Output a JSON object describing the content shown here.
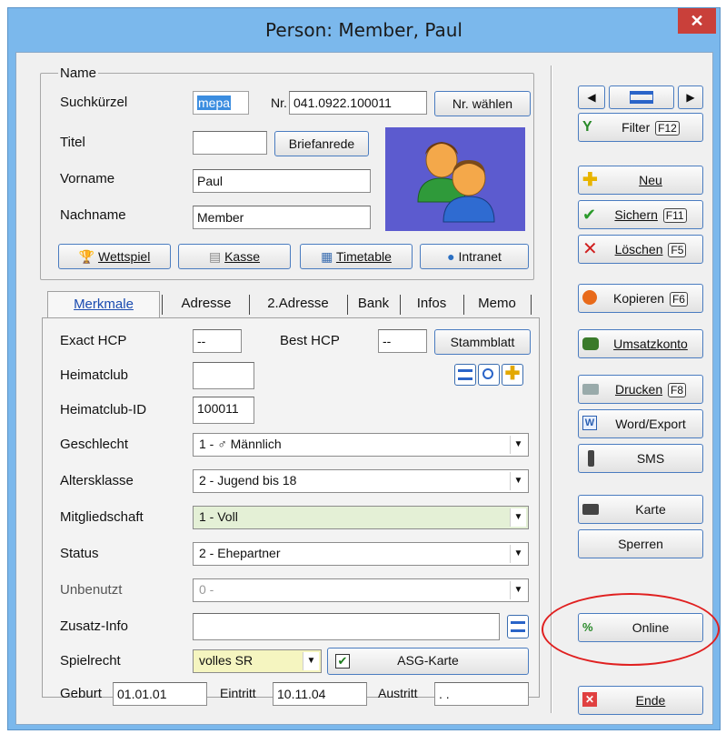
{
  "window": {
    "title": "Person: Member, Paul",
    "close_glyph": "✕"
  },
  "name_group": {
    "legend": "Name",
    "suchkuerzel_label": "Suchkürzel",
    "suchkuerzel_value": "mepa",
    "nr_label": "Nr.",
    "nr_value": "041.0922.100011",
    "nr_waehlen": "Nr. wählen",
    "titel_label": "Titel",
    "titel_value": "",
    "briefanrede": "Briefanrede",
    "vorname_label": "Vorname",
    "vorname_value": "Paul",
    "nachname_label": "Nachname",
    "nachname_value": "Member",
    "avatar_icon": "people-icon"
  },
  "quick_buttons": {
    "wettspiel": "Wettspiel",
    "kasse": "Kasse",
    "timetable": "Timetable",
    "intranet": "Intranet"
  },
  "tabs": [
    "Merkmale",
    "Adresse",
    "2.Adresse",
    "Bank",
    "Infos",
    "Memo"
  ],
  "merkmale": {
    "exact_hcp_label": "Exact HCP",
    "exact_hcp_value": "--",
    "best_hcp_label": "Best HCP",
    "best_hcp_value": "--",
    "stammblatt": "Stammblatt",
    "heimatclub_label": "Heimatclub",
    "heimatclub_value": "",
    "heimatclub_id_label": "Heimatclub-ID",
    "heimatclub_id_value": "100011",
    "geschlecht_label": "Geschlecht",
    "geschlecht_value": "1 - ♂ Männlich",
    "altersklasse_label": "Altersklasse",
    "altersklasse_value": "2 - Jugend bis 18",
    "mitgliedschaft_label": "Mitgliedschaft",
    "mitgliedschaft_value": "1 - Voll",
    "status_label": "Status",
    "status_value": "2 - Ehepartner",
    "unbenutzt_label": "Unbenutzt",
    "unbenutzt_value": "0 -",
    "zusatz_label": "Zusatz-Info",
    "zusatz_value": "",
    "spielrecht_label": "Spielrecht",
    "spielrecht_value": "volles SR",
    "asg_karte": "ASG-Karte",
    "asg_checked": true,
    "geburt_label": "Geburt",
    "geburt_value": "01.01.01",
    "eintritt_label": "Eintritt",
    "eintritt_value": "10.11.04",
    "austritt_label": "Austritt",
    "austritt_value": " .  ."
  },
  "right_panel": {
    "filter": "Filter",
    "filter_key": "F12",
    "neu": "Neu",
    "sichern": "Sichern",
    "sichern_key": "F11",
    "loeschen": "Löschen",
    "loeschen_key": "F5",
    "kopieren": "Kopieren",
    "kopieren_key": "F6",
    "umsatzkonto": "Umsatzkonto",
    "drucken": "Drucken",
    "drucken_key": "F8",
    "word_export": "Word/Export",
    "sms": "SMS",
    "karte": "Karte",
    "sperren": "Sperren",
    "online": "Online",
    "ende": "Ende"
  },
  "colors": {
    "accent_border": "#4a7cc0",
    "window_frame": "#7bb8ec",
    "mitgliedschaft_bg": "#e4f0d6",
    "spielrecht_bg": "#f5f5c0",
    "highlight_circle": "#e02020"
  }
}
